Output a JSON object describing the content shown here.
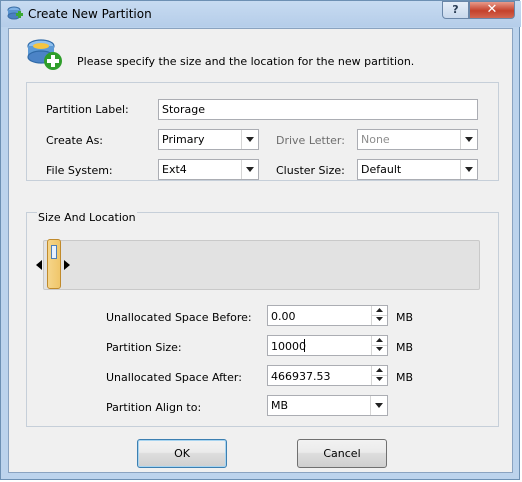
{
  "window": {
    "title": "Create New Partition",
    "help_label": "?",
    "close_label": "✕",
    "icon": "partition-add-icon"
  },
  "header": {
    "instruction": "Please specify the size and the location for the new partition.",
    "icon": "disk-add-icon"
  },
  "settings": {
    "partition_label": {
      "label": "Partition Label:",
      "value": "Storage"
    },
    "create_as": {
      "label": "Create As:",
      "value": "Primary"
    },
    "drive_letter": {
      "label": "Drive Letter:",
      "value": "None",
      "enabled": false
    },
    "file_system": {
      "label": "File System:",
      "value": "Ext4"
    },
    "cluster_size": {
      "label": "Cluster Size:",
      "value": "Default"
    }
  },
  "size_location": {
    "title": "Size And Location",
    "unallocated_before": {
      "label": "Unallocated Space Before:",
      "value": "0.00",
      "unit": "MB"
    },
    "partition_size": {
      "label": "Partition Size:",
      "value": "10000",
      "unit": "MB"
    },
    "unallocated_after": {
      "label": "Unallocated Space After:",
      "value": "466937.53",
      "unit": "MB"
    },
    "align": {
      "label": "Partition Align to:",
      "value": "MB"
    }
  },
  "buttons": {
    "ok": "OK",
    "cancel": "Cancel"
  },
  "colors": {
    "frame": "#bcd3ec",
    "close": "#c5412b",
    "handle": "#f0c66a",
    "accent_blue": "#4d7fb8",
    "accent_green": "#3aa935"
  }
}
